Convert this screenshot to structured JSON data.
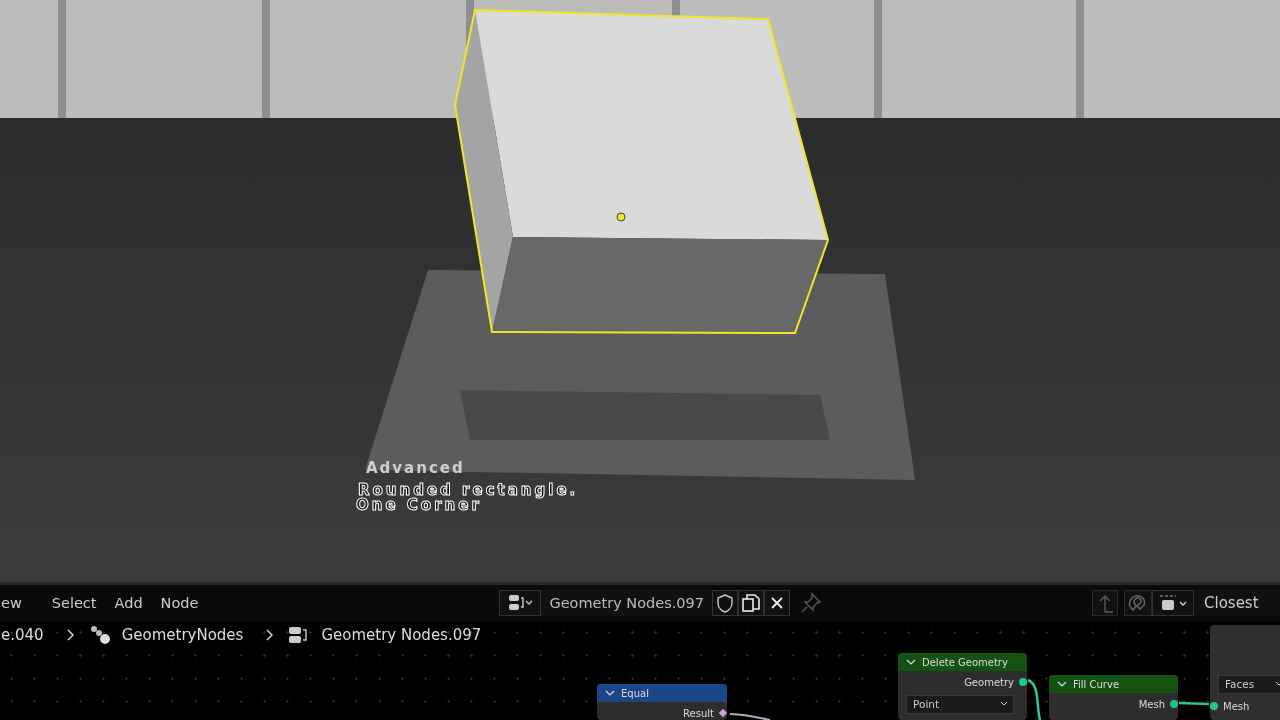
{
  "viewport": {
    "scene_texts": [
      {
        "text": "Advanced",
        "kind": "solid"
      },
      {
        "text": "Rounded rectangle.",
        "kind": "outline"
      },
      {
        "text": "One Corner",
        "kind": "outline"
      }
    ]
  },
  "header": {
    "menus": [
      "ew",
      "Select",
      "Add",
      "Node"
    ],
    "node_group": "Geometry Nodes.097",
    "snap_mode": "Closest"
  },
  "breadcrumbs": [
    "e.040",
    "GeometryNodes",
    "Geometry Nodes.097"
  ],
  "nodes": [
    {
      "title": "Equal",
      "kind": "math",
      "rows": [
        {
          "kind": "output",
          "label": "Result"
        }
      ]
    },
    {
      "title": "Delete Geometry",
      "kind": "geometry",
      "rows": [
        {
          "kind": "output",
          "label": "Geometry"
        },
        {
          "kind": "dropdown",
          "label": "Point"
        }
      ]
    },
    {
      "title": "Fill Curve",
      "kind": "geometry",
      "rows": [
        {
          "kind": "output",
          "label": "Mesh"
        }
      ]
    },
    {
      "kind": "plain",
      "rows": [
        {
          "kind": "dropdown",
          "label": "Faces"
        },
        {
          "kind": "input",
          "label": "Mesh"
        }
      ]
    }
  ]
}
